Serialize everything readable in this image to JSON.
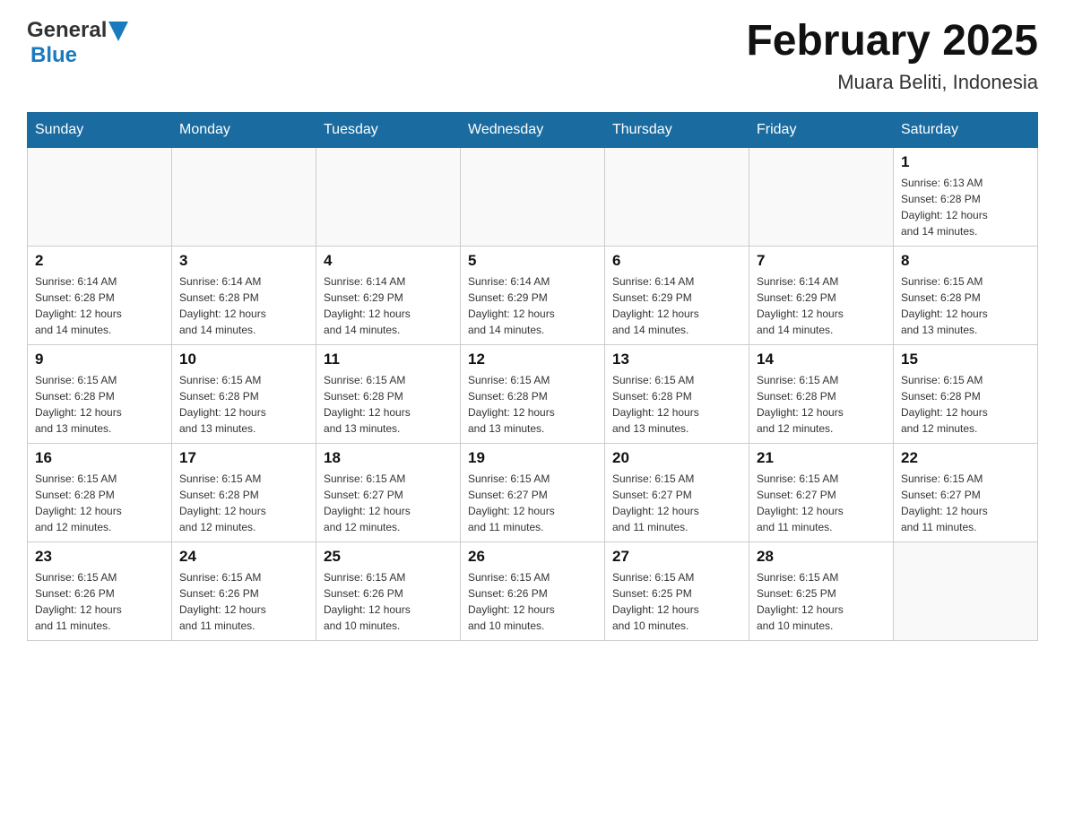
{
  "header": {
    "logo_general": "General",
    "logo_blue": "Blue",
    "title": "February 2025",
    "subtitle": "Muara Beliti, Indonesia"
  },
  "days_of_week": [
    "Sunday",
    "Monday",
    "Tuesday",
    "Wednesday",
    "Thursday",
    "Friday",
    "Saturday"
  ],
  "weeks": [
    [
      {
        "day": "",
        "info": ""
      },
      {
        "day": "",
        "info": ""
      },
      {
        "day": "",
        "info": ""
      },
      {
        "day": "",
        "info": ""
      },
      {
        "day": "",
        "info": ""
      },
      {
        "day": "",
        "info": ""
      },
      {
        "day": "1",
        "info": "Sunrise: 6:13 AM\nSunset: 6:28 PM\nDaylight: 12 hours\nand 14 minutes."
      }
    ],
    [
      {
        "day": "2",
        "info": "Sunrise: 6:14 AM\nSunset: 6:28 PM\nDaylight: 12 hours\nand 14 minutes."
      },
      {
        "day": "3",
        "info": "Sunrise: 6:14 AM\nSunset: 6:28 PM\nDaylight: 12 hours\nand 14 minutes."
      },
      {
        "day": "4",
        "info": "Sunrise: 6:14 AM\nSunset: 6:29 PM\nDaylight: 12 hours\nand 14 minutes."
      },
      {
        "day": "5",
        "info": "Sunrise: 6:14 AM\nSunset: 6:29 PM\nDaylight: 12 hours\nand 14 minutes."
      },
      {
        "day": "6",
        "info": "Sunrise: 6:14 AM\nSunset: 6:29 PM\nDaylight: 12 hours\nand 14 minutes."
      },
      {
        "day": "7",
        "info": "Sunrise: 6:14 AM\nSunset: 6:29 PM\nDaylight: 12 hours\nand 14 minutes."
      },
      {
        "day": "8",
        "info": "Sunrise: 6:15 AM\nSunset: 6:28 PM\nDaylight: 12 hours\nand 13 minutes."
      }
    ],
    [
      {
        "day": "9",
        "info": "Sunrise: 6:15 AM\nSunset: 6:28 PM\nDaylight: 12 hours\nand 13 minutes."
      },
      {
        "day": "10",
        "info": "Sunrise: 6:15 AM\nSunset: 6:28 PM\nDaylight: 12 hours\nand 13 minutes."
      },
      {
        "day": "11",
        "info": "Sunrise: 6:15 AM\nSunset: 6:28 PM\nDaylight: 12 hours\nand 13 minutes."
      },
      {
        "day": "12",
        "info": "Sunrise: 6:15 AM\nSunset: 6:28 PM\nDaylight: 12 hours\nand 13 minutes."
      },
      {
        "day": "13",
        "info": "Sunrise: 6:15 AM\nSunset: 6:28 PM\nDaylight: 12 hours\nand 13 minutes."
      },
      {
        "day": "14",
        "info": "Sunrise: 6:15 AM\nSunset: 6:28 PM\nDaylight: 12 hours\nand 12 minutes."
      },
      {
        "day": "15",
        "info": "Sunrise: 6:15 AM\nSunset: 6:28 PM\nDaylight: 12 hours\nand 12 minutes."
      }
    ],
    [
      {
        "day": "16",
        "info": "Sunrise: 6:15 AM\nSunset: 6:28 PM\nDaylight: 12 hours\nand 12 minutes."
      },
      {
        "day": "17",
        "info": "Sunrise: 6:15 AM\nSunset: 6:28 PM\nDaylight: 12 hours\nand 12 minutes."
      },
      {
        "day": "18",
        "info": "Sunrise: 6:15 AM\nSunset: 6:27 PM\nDaylight: 12 hours\nand 12 minutes."
      },
      {
        "day": "19",
        "info": "Sunrise: 6:15 AM\nSunset: 6:27 PM\nDaylight: 12 hours\nand 11 minutes."
      },
      {
        "day": "20",
        "info": "Sunrise: 6:15 AM\nSunset: 6:27 PM\nDaylight: 12 hours\nand 11 minutes."
      },
      {
        "day": "21",
        "info": "Sunrise: 6:15 AM\nSunset: 6:27 PM\nDaylight: 12 hours\nand 11 minutes."
      },
      {
        "day": "22",
        "info": "Sunrise: 6:15 AM\nSunset: 6:27 PM\nDaylight: 12 hours\nand 11 minutes."
      }
    ],
    [
      {
        "day": "23",
        "info": "Sunrise: 6:15 AM\nSunset: 6:26 PM\nDaylight: 12 hours\nand 11 minutes."
      },
      {
        "day": "24",
        "info": "Sunrise: 6:15 AM\nSunset: 6:26 PM\nDaylight: 12 hours\nand 11 minutes."
      },
      {
        "day": "25",
        "info": "Sunrise: 6:15 AM\nSunset: 6:26 PM\nDaylight: 12 hours\nand 10 minutes."
      },
      {
        "day": "26",
        "info": "Sunrise: 6:15 AM\nSunset: 6:26 PM\nDaylight: 12 hours\nand 10 minutes."
      },
      {
        "day": "27",
        "info": "Sunrise: 6:15 AM\nSunset: 6:25 PM\nDaylight: 12 hours\nand 10 minutes."
      },
      {
        "day": "28",
        "info": "Sunrise: 6:15 AM\nSunset: 6:25 PM\nDaylight: 12 hours\nand 10 minutes."
      },
      {
        "day": "",
        "info": ""
      }
    ]
  ]
}
